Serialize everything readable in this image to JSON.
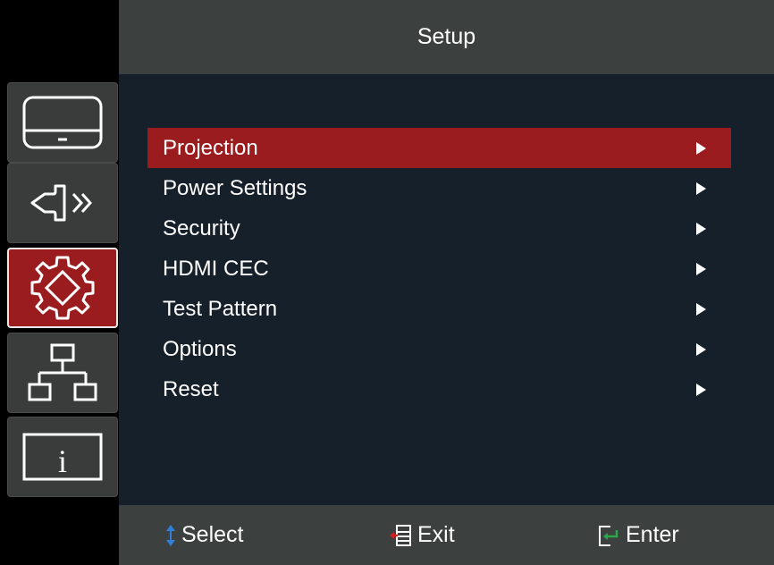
{
  "header": {
    "title": "Setup"
  },
  "sidebar": {
    "items": [
      {
        "icon": "display-icon",
        "active": false
      },
      {
        "icon": "audio-icon",
        "active": false
      },
      {
        "icon": "gear-icon",
        "active": true
      },
      {
        "icon": "network-icon",
        "active": false
      },
      {
        "icon": "info-icon",
        "active": false
      }
    ]
  },
  "menu": {
    "items": [
      {
        "label": "Projection",
        "selected": true
      },
      {
        "label": "Power Settings",
        "selected": false
      },
      {
        "label": "Security",
        "selected": false
      },
      {
        "label": "HDMI CEC",
        "selected": false
      },
      {
        "label": "Test Pattern",
        "selected": false
      },
      {
        "label": "Options",
        "selected": false
      },
      {
        "label": "Reset",
        "selected": false
      }
    ]
  },
  "footer": {
    "select_label": "Select",
    "exit_label": "Exit",
    "enter_label": "Enter"
  },
  "colors": {
    "accent": "#9b1c1f",
    "panel": "#16202a",
    "bar": "#3c403f",
    "select_icon": "#2f7fd6",
    "exit_icon": "#d62020",
    "enter_icon": "#2aa84a"
  }
}
